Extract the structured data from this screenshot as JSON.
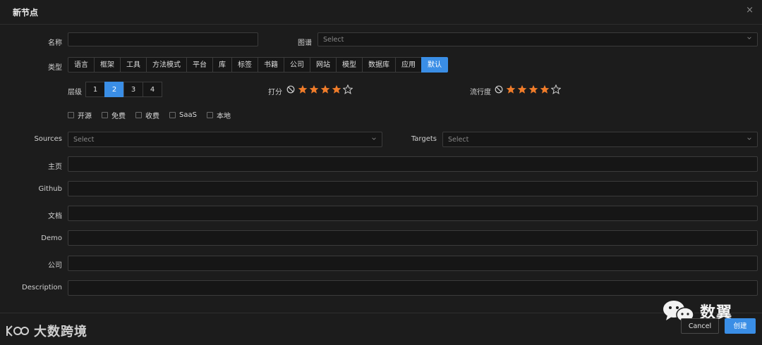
{
  "dialog": {
    "title": "新节点",
    "close_glyph": "×"
  },
  "name": {
    "label": "名称",
    "value": ""
  },
  "graph": {
    "label": "图谱",
    "placeholder": "Select"
  },
  "type": {
    "label": "类型",
    "options": [
      "语言",
      "框架",
      "工具",
      "方法模式",
      "平台",
      "库",
      "标签",
      "书籍",
      "公司",
      "网站",
      "模型",
      "数据库",
      "应用",
      "默认"
    ],
    "selected": "默认"
  },
  "level": {
    "label": "层级",
    "options": [
      "1",
      "2",
      "3",
      "4"
    ],
    "selected": "2"
  },
  "score": {
    "label": "打分",
    "value": 4,
    "max": 5
  },
  "popularity": {
    "label": "流行度",
    "value": 4,
    "max": 5
  },
  "flags": [
    "开源",
    "免费",
    "收费",
    "SaaS",
    "本地"
  ],
  "sources": {
    "label": "Sources",
    "placeholder": "Select"
  },
  "targets": {
    "label": "Targets",
    "placeholder": "Select"
  },
  "homepage": {
    "label": "主页",
    "value": ""
  },
  "github": {
    "label": "Github",
    "value": ""
  },
  "docs": {
    "label": "文档",
    "value": ""
  },
  "demo": {
    "label": "Demo",
    "value": ""
  },
  "company": {
    "label": "公司",
    "value": ""
  },
  "description": {
    "label": "Description",
    "value": ""
  },
  "footer": {
    "cancel_label": "Cancel",
    "create_label": "创建"
  },
  "watermarks": {
    "left_brand": "大数跨境",
    "right_brand": "数翼"
  },
  "colors": {
    "accent": "#3a8ee6",
    "star": "#f07c2a",
    "background": "#1c1c1c"
  }
}
